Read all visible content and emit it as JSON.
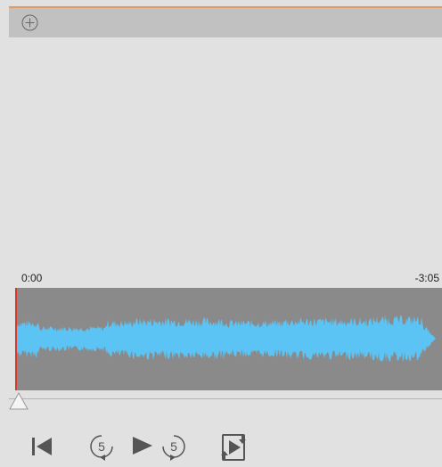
{
  "player": {
    "time_elapsed": "0:00",
    "time_remaining": "-3:05",
    "progress": 0.0,
    "skip_back_seconds": "5",
    "skip_forward_seconds": "5"
  },
  "colors": {
    "waveform": "#5bc4f5",
    "waveform_bg": "#8a8a8a",
    "playhead": "#d8372b",
    "toolbar": "#c1c1c1",
    "accent": "#e39a63"
  },
  "icons": {
    "add": "add-circle-icon",
    "previous": "skip-to-start-icon",
    "rewind": "rewind-5-icon",
    "play": "play-icon",
    "forward": "forward-5-icon",
    "loop": "repeat-play-icon"
  }
}
